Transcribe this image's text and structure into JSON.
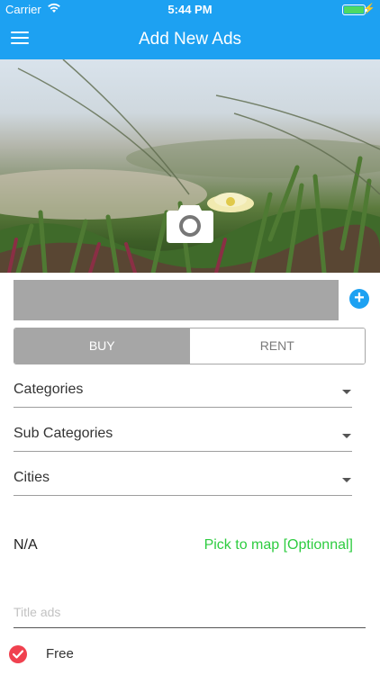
{
  "status_bar": {
    "carrier": "Carrier",
    "time": "5:44 PM",
    "battery_level": 1.0
  },
  "nav": {
    "title": "Add New Ads",
    "menu_icon": "hamburger-menu-icon"
  },
  "hero": {
    "camera_icon": "camera-icon"
  },
  "images": {
    "add_icon": "plus-circle-icon"
  },
  "ad_type": {
    "options": [
      "BUY",
      "RENT"
    ],
    "selected": "BUY"
  },
  "dropdowns": {
    "categories": "Categories",
    "sub_categories": "Sub Categories",
    "cities": "Cities"
  },
  "location": {
    "value": "N/A",
    "pick_label": "Pick to map [Optionnal]"
  },
  "title_field": {
    "placeholder": "Title ads",
    "value": ""
  },
  "free": {
    "label": "Free",
    "checked": true
  },
  "colors": {
    "primary": "#1da1f2",
    "pick_map": "#2ecc40",
    "check": "#f0414f",
    "segment_active": "#a6a6a6"
  }
}
